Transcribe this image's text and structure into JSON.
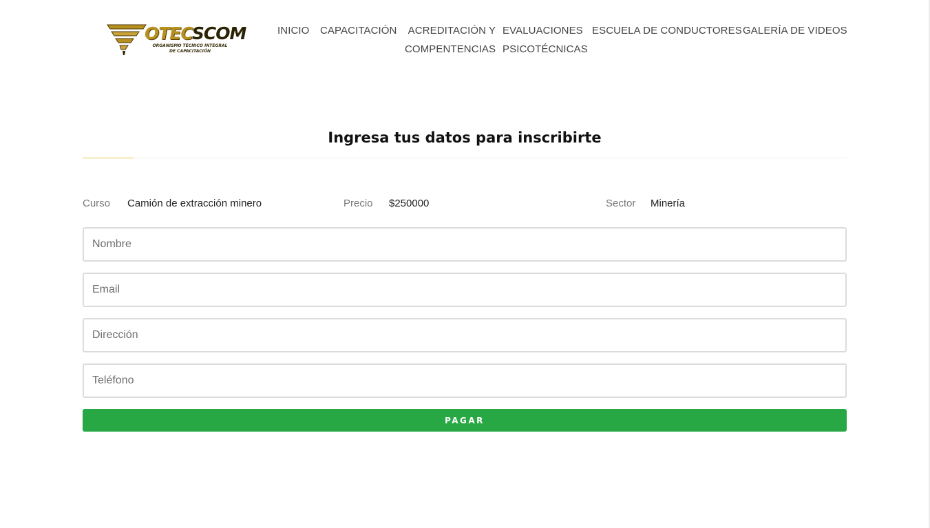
{
  "brand": {
    "name_part1": "OTEC",
    "name_part2": "SCOM",
    "tagline_line1": "ORGANISMO TÉCNICO INTEGRAL",
    "tagline_line2": "DE CAPACITACIÓN",
    "colors": {
      "gold": "#b8901e",
      "dark": "#2b2204"
    }
  },
  "nav": {
    "items": [
      {
        "label": "INICIO"
      },
      {
        "label": "CAPACITACIÓN"
      },
      {
        "label_line1": "ACREDITACIÓN Y",
        "label_line2": "COMPENTENCIAS"
      },
      {
        "label_line1": "EVALUACIONES",
        "label_line2": "PSICOTÉCNICAS"
      },
      {
        "label": "ESCUELA DE CONDUCTORES"
      },
      {
        "label": "GALERÍA DE VIDEOS"
      }
    ]
  },
  "form": {
    "title": "Ingresa tus datos para inscribirte",
    "info": {
      "curso_label": "Curso",
      "curso_value": "Camión de extracción minero",
      "precio_label": "Precio",
      "precio_value": "$250000",
      "sector_label": "Sector",
      "sector_value": "Minería"
    },
    "fields": {
      "nombre_placeholder": "Nombre",
      "email_placeholder": "Email",
      "direccion_placeholder": "Dirección",
      "telefono_placeholder": "Teléfono"
    },
    "submit_label": "PAGAR",
    "colors": {
      "submit": "#28a745",
      "accent_rule": "#e3c54a"
    }
  }
}
